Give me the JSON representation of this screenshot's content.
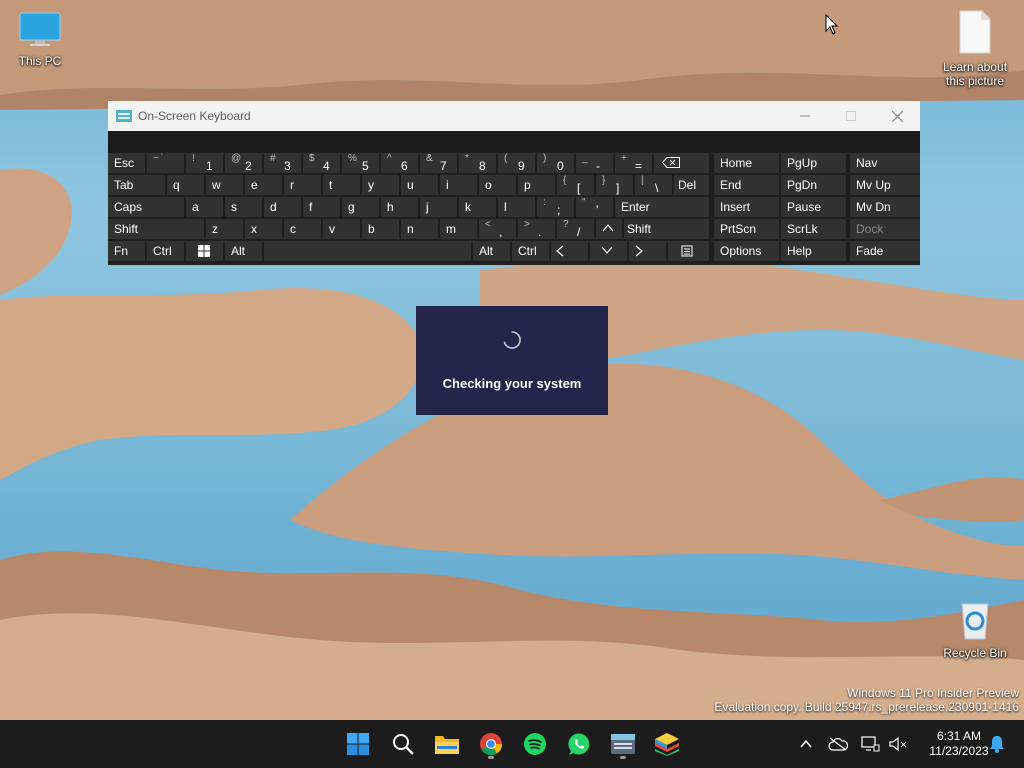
{
  "desktop": {
    "icons": [
      {
        "name": "This PC"
      },
      {
        "name": "Learn about this picture"
      },
      {
        "name": "Recycle Bin"
      }
    ],
    "watermark": {
      "line1": "Windows 11 Pro Insider Preview",
      "line2": "Evaluation copy. Build 25947.rs_prerelease.230901-1416"
    }
  },
  "osk": {
    "title": "On-Screen Keyboard",
    "rows": {
      "row1": [
        "Esc",
        "~",
        "`",
        "!",
        "1",
        "@",
        "2",
        "#",
        "3",
        "$",
        "4",
        "%",
        "5",
        "^",
        "6",
        "&",
        "7",
        "*",
        "8",
        "(",
        "9",
        ")",
        "0",
        "_",
        "-",
        "+",
        "="
      ],
      "row2": [
        "Tab",
        "q",
        "w",
        "e",
        "r",
        "t",
        "y",
        "u",
        "i",
        "o",
        "p",
        "{",
        "[",
        "}",
        "]",
        "|",
        "\\",
        "Del"
      ],
      "row3": [
        "Caps",
        "a",
        "s",
        "d",
        "f",
        "g",
        "h",
        "j",
        "k",
        "l",
        ":",
        ";",
        "\"",
        "'",
        "Enter"
      ],
      "row4": [
        "Shift",
        "z",
        "x",
        "c",
        "v",
        "b",
        "n",
        "m",
        "<",
        ",",
        ">",
        ".",
        "?",
        "/",
        "Shift"
      ],
      "row5": [
        "Fn",
        "Ctrl",
        "Alt",
        "Alt",
        "Ctrl"
      ]
    },
    "nav": [
      "Home",
      "PgUp",
      "Nav",
      "End",
      "PgDn",
      "Mv Up",
      "Insert",
      "Pause",
      "Mv Dn",
      "PrtScn",
      "ScrLk",
      "Dock",
      "Options",
      "Help",
      "Fade"
    ]
  },
  "dialog": {
    "message": "Checking your system"
  },
  "clock": {
    "time": "6:31 AM",
    "date": "11/23/2023"
  },
  "colors": {
    "taskbar": "#1c1c1c",
    "key": "#323232",
    "dialog": "#23254a"
  }
}
